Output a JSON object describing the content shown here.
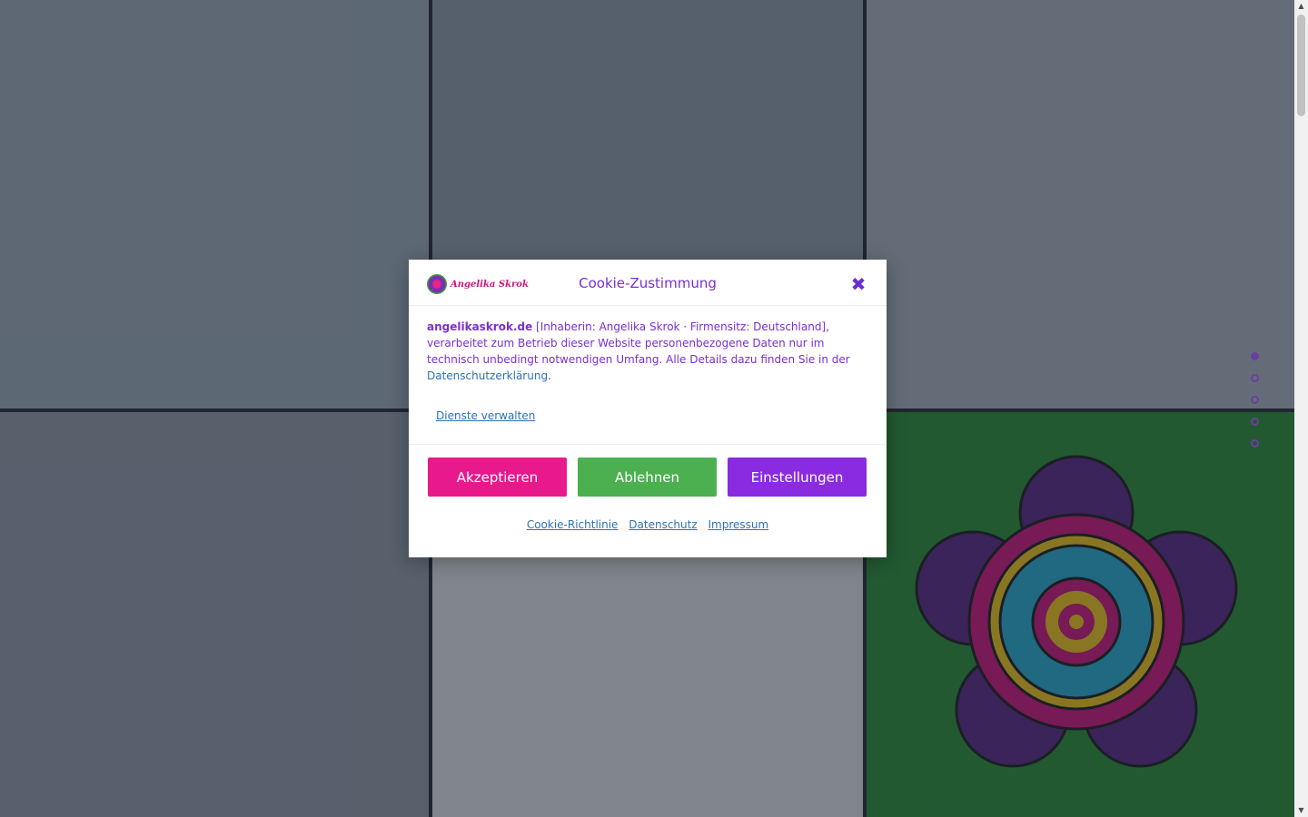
{
  "modal": {
    "logo_text": "Angelika Skrok",
    "title": "Cookie-Zustimmung",
    "close_symbol": "✖",
    "body_site": "angelikaskrok.de",
    "body_text": " [Inhaberin: Angelika Skrok · Firmensitz: Deutschland], verarbeitet zum Betrieb dieser Website personenbezogene Daten nur im technisch unbedingt notwendigen Umfang. Alle Details dazu finden Sie in der ",
    "body_link": "Datenschutzerklärung",
    "body_end": ".",
    "manage_link": "Dienste verwalten",
    "buttons": {
      "accept": "Akzeptieren",
      "deny": "Ablehnen",
      "settings": "Einstellungen"
    },
    "footer_links": [
      "Cookie-Richtlinie",
      "Datenschutz",
      "Impressum"
    ]
  },
  "slider": {
    "dot_count": 5,
    "active_index": 0
  },
  "colors": {
    "accent_pink": "#e8198b",
    "accent_green": "#4caf50",
    "accent_purple": "#8a2be2",
    "title_purple": "#7a2fd4"
  }
}
